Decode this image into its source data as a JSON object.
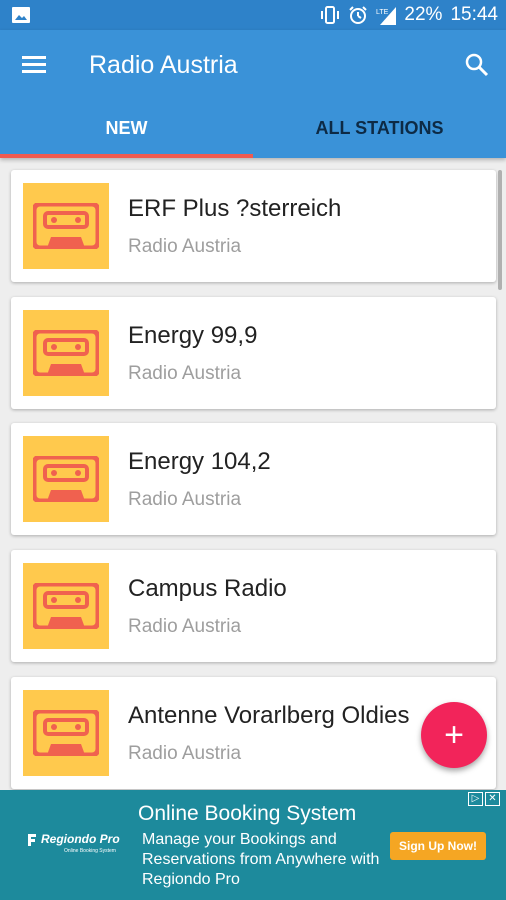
{
  "status_bar": {
    "battery_percent": "22%",
    "time": "15:44",
    "icons": [
      "image-icon",
      "vibrate-icon",
      "alarm-icon",
      "lte-icon",
      "signal-icon"
    ]
  },
  "app_bar": {
    "title": "Radio Austria",
    "menu_icon": "menu-icon",
    "search_icon": "search-icon"
  },
  "tabs": [
    {
      "label": "NEW",
      "active": true
    },
    {
      "label": "ALL STATIONS",
      "active": false
    }
  ],
  "stations": [
    {
      "name": "ERF Plus ?sterreich",
      "subtitle": "Radio Austria",
      "icon": "cassette-icon"
    },
    {
      "name": "Energy 99,9",
      "subtitle": "Radio Austria",
      "icon": "cassette-icon"
    },
    {
      "name": "Energy 104,2",
      "subtitle": "Radio Austria",
      "icon": "cassette-icon"
    },
    {
      "name": "Campus Radio",
      "subtitle": "Radio Austria",
      "icon": "cassette-icon"
    },
    {
      "name": "Antenne Vorarlberg Oldies",
      "subtitle": "Radio Austria",
      "icon": "cassette-icon"
    }
  ],
  "fab": {
    "label": "+"
  },
  "ad": {
    "brand": "Regiondo Pro",
    "brand_sub": "Online Booking System",
    "title": "Online Booking System",
    "body": "Manage your Bookings and Reservations from Anywhere with Regiondo Pro",
    "cta": "Sign Up Now!"
  },
  "colors": {
    "primary": "#3a92d8",
    "status_bar": "#2e82c9",
    "tab_indicator": "#f05a4f",
    "fab": "#f2245a",
    "thumb_bg": "#ffc94d",
    "cassette": "#f0614f",
    "ad_bg": "#1d8a9c",
    "ad_cta": "#f5a623"
  }
}
